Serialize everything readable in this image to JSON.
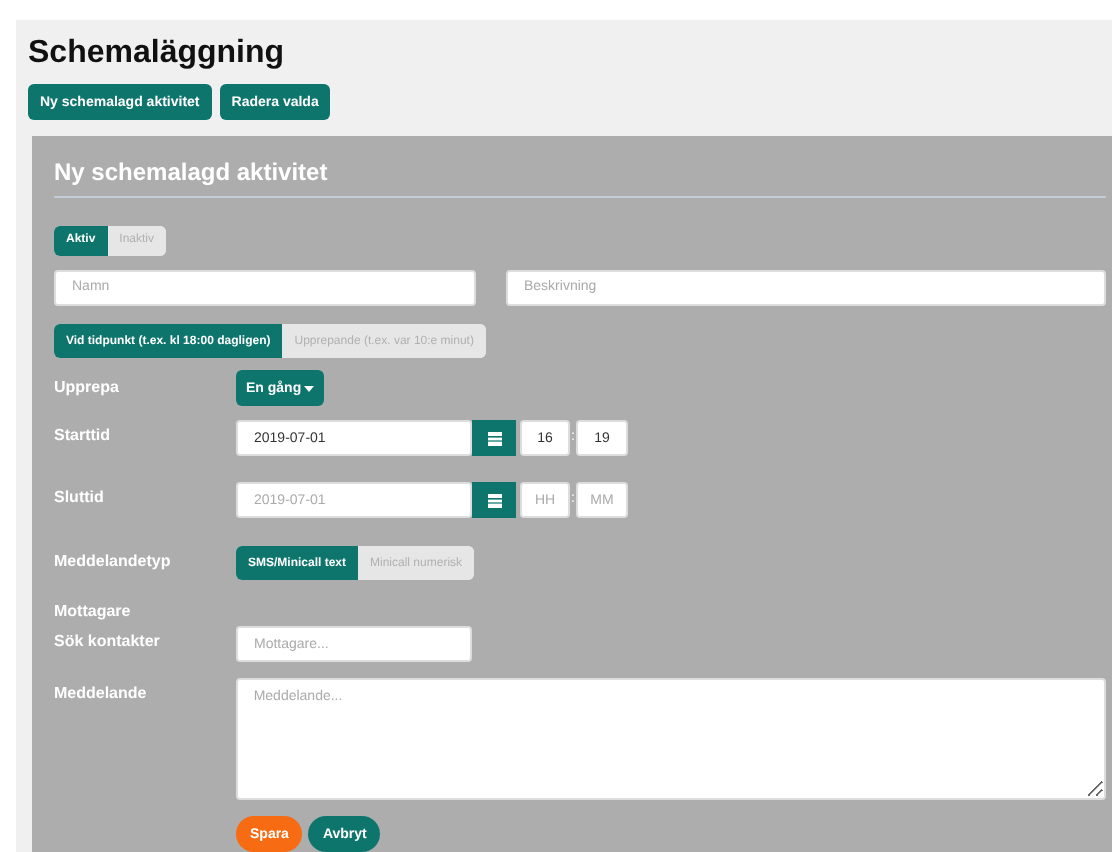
{
  "page": {
    "title": "Schemaläggning"
  },
  "toolbar": [
    {
      "label": "Ny schemalagd aktivitet"
    },
    {
      "label": "Radera valda"
    }
  ],
  "form": {
    "title": "Ny schemalagd aktivitet",
    "status_toggle": [
      {
        "label": "Aktiv",
        "selected": true
      },
      {
        "label": "Inaktiv",
        "selected": false
      }
    ],
    "name_field": {
      "placeholder": "Namn"
    },
    "description_field": {
      "placeholder": "Beskrivning"
    },
    "timing_toggle": [
      {
        "label": "Vid tidpunkt (t.ex. kl 18:00 dagligen)",
        "selected": true
      },
      {
        "label": "Upprepande (t.ex. var 10:e minut)",
        "selected": false
      }
    ],
    "rows": [
      {
        "kind": "dropdown",
        "label": "Upprepa",
        "value": "En gång"
      },
      {
        "kind": "datetime",
        "label": "Starttid",
        "date": {
          "value": "2019-07-01"
        },
        "hour": {
          "value": "16"
        },
        "minute": {
          "value": "19"
        },
        "separator": ":"
      },
      {
        "kind": "datetime",
        "label": "Sluttid",
        "date": {
          "placeholder": "2019-07-01"
        },
        "hour": {
          "placeholder": "HH"
        },
        "minute": {
          "placeholder": "MM"
        },
        "separator": ":"
      },
      {
        "kind": "toggle",
        "label": "Meddelandetyp",
        "options": [
          {
            "label": "SMS/Minicall text",
            "selected": true
          },
          {
            "label": "Minicall numerisk",
            "selected": false
          }
        ]
      },
      {
        "kind": "heading",
        "label": "Mottagare"
      },
      {
        "kind": "input",
        "label": "Sök kontakter",
        "placeholder": "Mottagare..."
      },
      {
        "kind": "textarea",
        "label": "Meddelande",
        "placeholder": "Meddelande..."
      }
    ],
    "actions": [
      {
        "label": "Spara",
        "kind": "primary"
      },
      {
        "label": "Avbryt",
        "kind": "secondary"
      }
    ]
  }
}
